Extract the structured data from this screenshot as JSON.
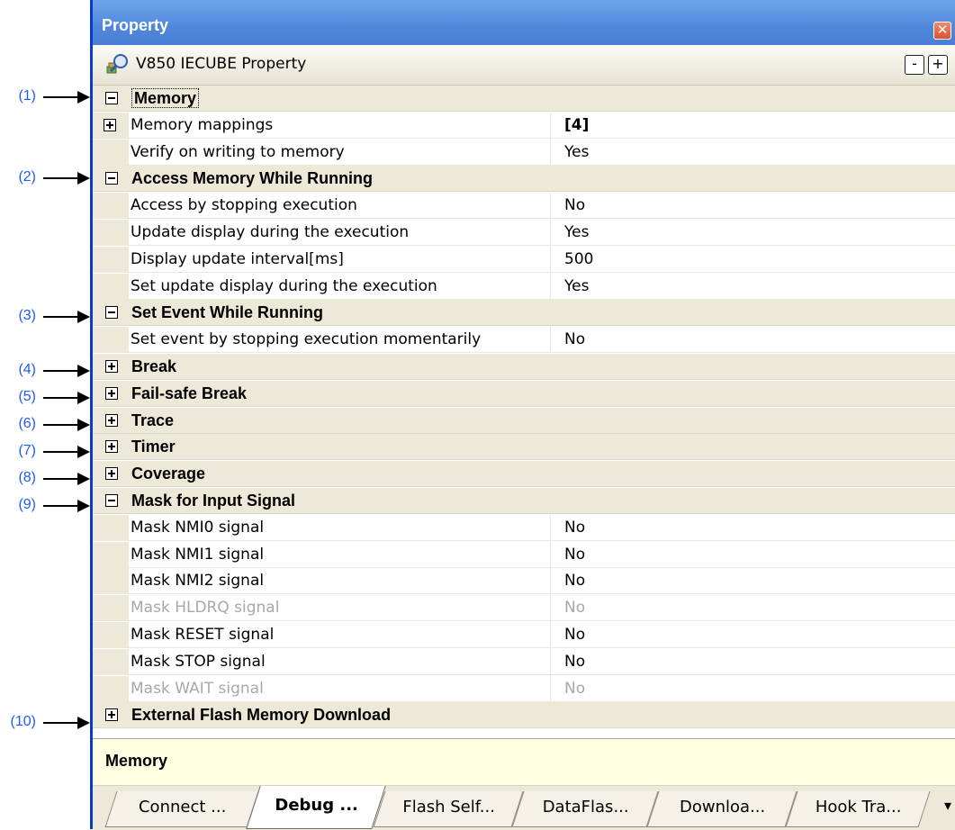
{
  "window": {
    "title": "Property",
    "close_label": "✕"
  },
  "toolbar": {
    "subtitle": "V850 IECUBE Property",
    "collapse_label": "-",
    "expand_label": "+"
  },
  "callouts": [
    "(1)",
    "(2)",
    "(3)",
    "(4)",
    "(5)",
    "(6)",
    "(7)",
    "(8)",
    "(9)",
    "(10)"
  ],
  "rows": [
    {
      "type": "category",
      "expander": "minus",
      "label": "Memory",
      "focused": true
    },
    {
      "type": "property",
      "expander": "plus",
      "label": "Memory mappings",
      "value": "[4]",
      "bold_value": true
    },
    {
      "type": "property",
      "label": "Verify on writing to memory",
      "value": "Yes"
    },
    {
      "type": "category",
      "expander": "minus",
      "label": "Access Memory While Running"
    },
    {
      "type": "property",
      "label": "Access by stopping execution",
      "value": "No"
    },
    {
      "type": "property",
      "label": "Update display during the execution",
      "value": "Yes"
    },
    {
      "type": "property",
      "label": "Display update interval[ms]",
      "value": "500"
    },
    {
      "type": "property",
      "label": "Set update display during the execution",
      "value": "Yes"
    },
    {
      "type": "category",
      "expander": "minus",
      "label": "Set Event While Running"
    },
    {
      "type": "property",
      "label": "Set event by stopping execution momentarily",
      "value": "No"
    },
    {
      "type": "category",
      "expander": "plus",
      "label": "Break"
    },
    {
      "type": "category",
      "expander": "plus",
      "label": "Fail-safe Break"
    },
    {
      "type": "category",
      "expander": "plus",
      "label": "Trace"
    },
    {
      "type": "category",
      "expander": "plus",
      "label": "Timer"
    },
    {
      "type": "category",
      "expander": "plus",
      "label": "Coverage"
    },
    {
      "type": "category",
      "expander": "minus",
      "label": "Mask for Input Signal"
    },
    {
      "type": "property",
      "label": "Mask NMI0 signal",
      "value": "No"
    },
    {
      "type": "property",
      "label": "Mask NMI1 signal",
      "value": "No"
    },
    {
      "type": "property",
      "label": "Mask NMI2 signal",
      "value": "No"
    },
    {
      "type": "property",
      "label": "Mask HLDRQ signal",
      "value": "No",
      "disabled": true
    },
    {
      "type": "property",
      "label": "Mask RESET signal",
      "value": "No"
    },
    {
      "type": "property",
      "label": "Mask STOP signal",
      "value": "No"
    },
    {
      "type": "property",
      "label": "Mask WAIT signal",
      "value": "No",
      "disabled": true
    },
    {
      "type": "category",
      "expander": "plus",
      "label": "External Flash Memory Download"
    }
  ],
  "description": {
    "text": "Memory"
  },
  "tabs": [
    {
      "label": "Connect ...",
      "active": false
    },
    {
      "label": "Debug ...",
      "active": true
    },
    {
      "label": "Flash Self...",
      "active": false
    },
    {
      "label": "DataFlas...",
      "active": false
    },
    {
      "label": "Downloa...",
      "active": false
    },
    {
      "label": "Hook Tra...",
      "active": false
    }
  ],
  "tab_overflow_label": "▾",
  "colors": {
    "accent": "#0a3cc8",
    "callout": "#1e5aff",
    "category_bg": "#ece9d8",
    "description_bg": "#ffffe1"
  }
}
